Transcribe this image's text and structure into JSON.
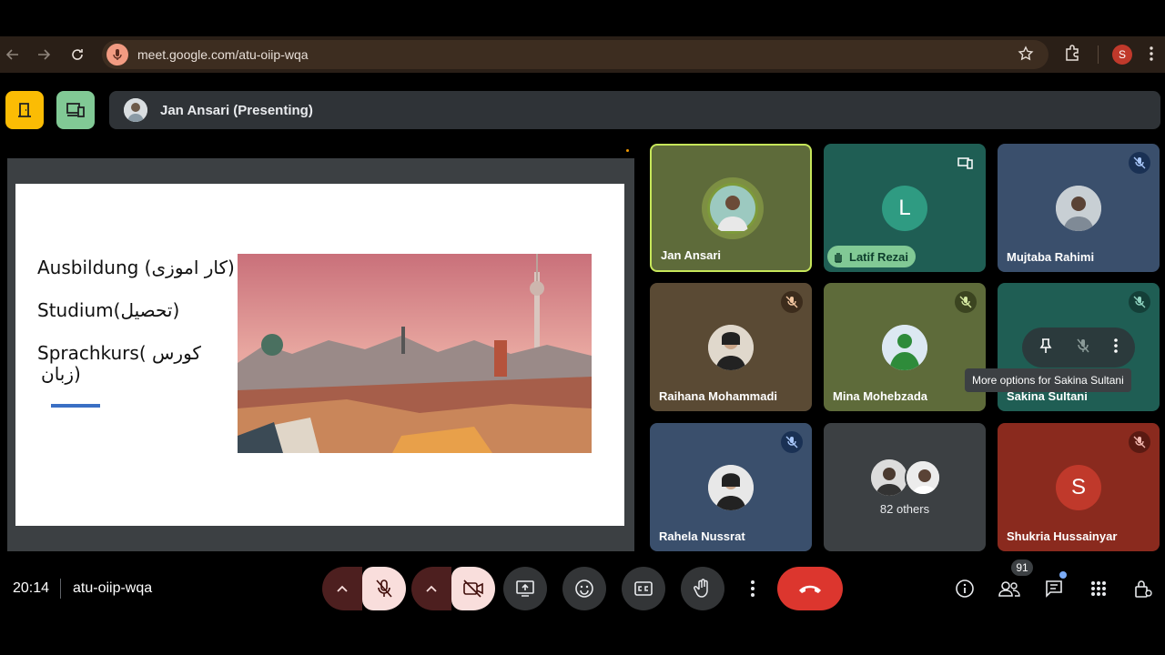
{
  "browser": {
    "url": "meet.google.com/atu-oiip-wqa",
    "profile_initial": "S"
  },
  "meet": {
    "presenter_label": "Jan Ansari (Presenting)",
    "time": "20:14",
    "meeting_code": "atu-oiip-wqa",
    "participants_count": "91"
  },
  "slide": {
    "line1": "Ausbildung (کار اموزی)",
    "line2": "Studium(تحصیل)",
    "line3a": "Sprachkurs( کورس",
    "line3b": "زبان)"
  },
  "tiles": [
    {
      "name": "Jan Ansari"
    },
    {
      "name": "Latif Rezai",
      "initial": "L"
    },
    {
      "name": "Mujtaba Rahimi"
    },
    {
      "name": "Raihana Mohammadi"
    },
    {
      "name": "Mina Mohebzada"
    },
    {
      "name": "Sakina Sultani"
    },
    {
      "name": "Rahela Nussrat"
    },
    {
      "others": "82 others"
    },
    {
      "name": "Shukria Hussainyar",
      "initial": "S"
    }
  ],
  "tooltip": "More options for Sakina Sultani",
  "colors": {
    "accent_yellow": "#fbbc04",
    "accent_green": "#81c995",
    "end_call": "#dc362e",
    "active_border": "#c6e65a"
  }
}
